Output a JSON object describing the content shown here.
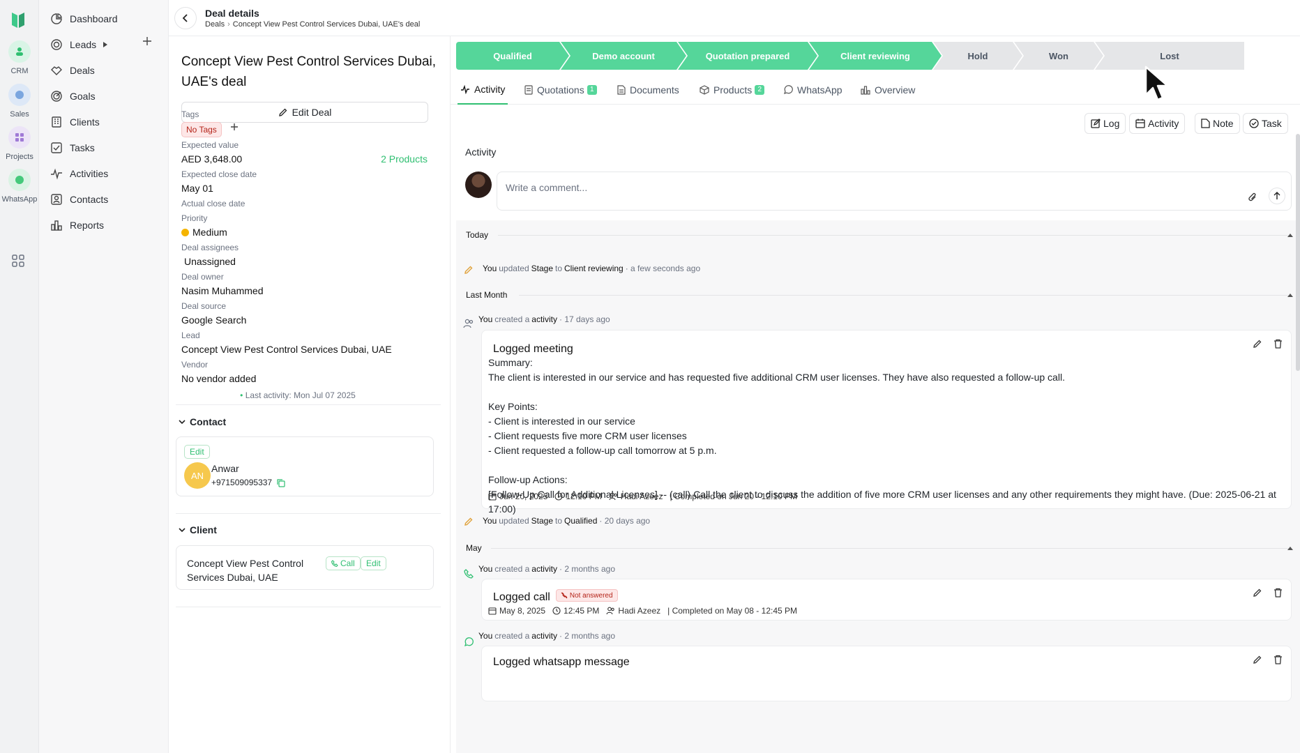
{
  "rail": {
    "apps": [
      {
        "label": "CRM",
        "icon": "crm-icon"
      },
      {
        "label": "Sales",
        "icon": "sales-icon"
      },
      {
        "label": "Projects",
        "icon": "projects-icon"
      },
      {
        "label": "WhatsApp",
        "icon": "whatsapp-icon"
      }
    ]
  },
  "nav": {
    "items": [
      {
        "label": "Dashboard",
        "icon": "pie-chart-icon"
      },
      {
        "label": "Leads",
        "icon": "target-icon"
      },
      {
        "label": "Deals",
        "icon": "handshake-icon"
      },
      {
        "label": "Goals",
        "icon": "goal-icon"
      },
      {
        "label": "Clients",
        "icon": "building-icon"
      },
      {
        "label": "Tasks",
        "icon": "checkbox-icon"
      },
      {
        "label": "Activities",
        "icon": "pulse-icon"
      },
      {
        "label": "Contacts",
        "icon": "contact-card-icon"
      },
      {
        "label": "Reports",
        "icon": "bar-chart-icon"
      }
    ]
  },
  "header": {
    "title": "Deal details",
    "breadcrumb_root": "Deals",
    "breadcrumb_current": "Concept View Pest Control Services Dubai, UAE's deal"
  },
  "details": {
    "title": "Concept View Pest Control Services Dubai, UAE's deal",
    "edit_label": "Edit Deal",
    "tags_label": "Tags",
    "tag_value": "No Tags",
    "expected_value_label": "Expected value",
    "expected_value": "AED 3,648.00",
    "products_link": "2 Products",
    "expected_close_label": "Expected close date",
    "expected_close": "May 01",
    "actual_close_label": "Actual close date",
    "priority_label": "Priority",
    "priority": "Medium",
    "assignees_label": "Deal assignees",
    "assignees": "Unassigned",
    "owner_label": "Deal owner",
    "owner": "Nasim Muhammed",
    "source_label": "Deal source",
    "source": "Google Search",
    "lead_label": "Lead",
    "lead": "Concept View Pest Control Services Dubai, UAE",
    "vendor_label": "Vendor",
    "vendor": "No vendor added",
    "last_activity": "Last activity: Mon Jul 07 2025",
    "contact_section": "Contact",
    "contact_edit": "Edit",
    "contact_initials": "AN",
    "contact_name": "Anwar",
    "contact_phone": "+971509095337",
    "client_section": "Client",
    "client_name": "Concept View Pest Control Services Dubai, UAE",
    "client_call": "Call",
    "client_edit": "Edit"
  },
  "pipeline": {
    "stages": [
      {
        "label": "Qualified",
        "state": "done"
      },
      {
        "label": "Demo account",
        "state": "done"
      },
      {
        "label": "Quotation prepared",
        "state": "done"
      },
      {
        "label": "Client reviewing",
        "state": "done"
      },
      {
        "label": "Hold",
        "state": "todo"
      },
      {
        "label": "Won",
        "state": "todo"
      },
      {
        "label": "Lost",
        "state": "todo"
      }
    ],
    "done_color": "#55d69a",
    "todo_color": "#e5e6e8"
  },
  "tabs": [
    {
      "label": "Activity",
      "badge": "",
      "icon": "activity-icon"
    },
    {
      "label": "Quotations",
      "badge": "1",
      "icon": "document-icon"
    },
    {
      "label": "Documents",
      "badge": "",
      "icon": "file-icon"
    },
    {
      "label": "Products",
      "badge": "2",
      "icon": "box-icon"
    },
    {
      "label": "WhatsApp",
      "badge": "",
      "icon": "whatsapp-icon"
    },
    {
      "label": "Overview",
      "badge": "",
      "icon": "overview-icon"
    }
  ],
  "actions": {
    "log": "Log",
    "activity": "Activity",
    "note": "Note",
    "task": "Task"
  },
  "activity": {
    "section_label": "Activity",
    "comment_placeholder": "Write a comment...",
    "groups": {
      "today": "Today",
      "last_month": "Last Month",
      "may": "May"
    },
    "events": [
      {
        "who": "You",
        "text1": "updated",
        "field": "Stage",
        "text2": "to",
        "value": "Client reviewing",
        "time": "· a few seconds ago"
      },
      {
        "who": "You",
        "text1": "created a",
        "field": "activity",
        "time": "· 17 days ago"
      },
      {
        "who": "You",
        "text1": "updated",
        "field": "Stage",
        "text2": "to",
        "value": "Qualified",
        "time": "· 20 days ago"
      },
      {
        "who": "You",
        "text1": "created a",
        "field": "activity",
        "time": "· 2 months ago"
      },
      {
        "who": "You",
        "text1": "created a",
        "field": "activity",
        "time": "· 2 months ago"
      }
    ],
    "meeting": {
      "title": "Logged meeting",
      "body": "Summary:\nThe client is interested in our service and has requested five additional CRM user licenses. They have also requested a follow-up call.\n\nKey Points:\n- Client is interested in our service\n- Client requests five more CRM user licenses\n- Client requested a follow-up call tomorrow at 5 p.m.\n\nFollow-up Actions:\n[Follow-Up Call for Additional Licenses] -- (call) Call the client to discuss the addition of five more CRM user licenses and any other requirements they might have. (Due: 2025-06-21 at 17:00)",
      "date": "Jun 20, 2025",
      "time": "12:10 PM",
      "assignee": "Hadi Azeez",
      "completed": "| Completed on Jun 20 - 12:10 PM"
    },
    "call": {
      "title": "Logged call",
      "badge": "Not answered",
      "date": "May 8, 2025",
      "time": "12:45 PM",
      "assignee": "Hadi Azeez",
      "completed": "| Completed on May 08 - 12:45 PM"
    },
    "whatsapp": {
      "title": "Logged whatsapp message"
    }
  },
  "colors": {
    "accent": "#2fbf71",
    "danger": "#b42318"
  }
}
